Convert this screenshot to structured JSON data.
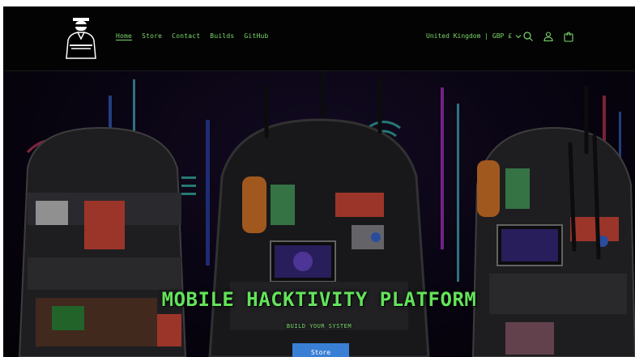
{
  "nav": {
    "items": [
      {
        "label": "Home",
        "active": true
      },
      {
        "label": "Store",
        "active": false
      },
      {
        "label": "Contact",
        "active": false
      },
      {
        "label": "Builds",
        "active": false
      },
      {
        "label": "GitHub",
        "active": false
      }
    ]
  },
  "header": {
    "region_label": "United Kingdom | GBP £",
    "icons": [
      "logo-icon",
      "chevron-down-icon",
      "search-icon",
      "account-icon",
      "cart-icon"
    ]
  },
  "hero": {
    "title": "MOBILE HACKTIVITY PLATFORM",
    "subtitle": "BUILD YOUR SYSTEM",
    "button_label": "Store"
  },
  "colors": {
    "accent_green": "#63e35a",
    "nav_green": "#7bd86a",
    "button_blue": "#3a7fd6",
    "header_bg": "#030303"
  }
}
